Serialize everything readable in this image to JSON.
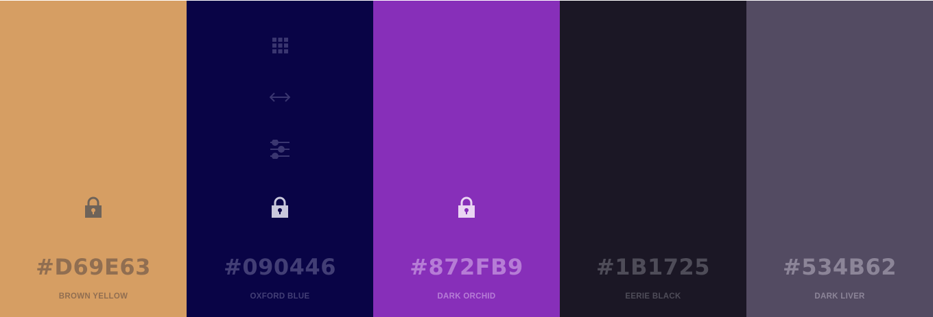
{
  "colors": [
    {
      "hex": "#D69E63",
      "name": "BROWN YELLOW",
      "bg": "#D69E63",
      "text": "rgba(60,50,60,0.45)",
      "lock": "#6e6359",
      "lock_visible": true
    },
    {
      "hex": "#090446",
      "name": "OXFORD BLUE",
      "bg": "#090446",
      "text": "rgba(200,200,230,0.3)",
      "lock": "#c9c8dc",
      "lock_visible": true,
      "tools": [
        "grid-icon",
        "arrows-horizontal-icon",
        "sliders-icon"
      ]
    },
    {
      "hex": "#872FB9",
      "name": "DARK ORCHID",
      "bg": "#872FB9",
      "text": "rgba(240,220,250,0.45)",
      "lock": "#ead5f3",
      "lock_visible": true
    },
    {
      "hex": "#1B1725",
      "name": "EERIE BLACK",
      "bg": "#1B1725",
      "text": "rgba(200,200,210,0.3)",
      "lock": "#888",
      "lock_visible": false
    },
    {
      "hex": "#534B62",
      "name": "DARK LIVER",
      "bg": "#534B62",
      "text": "rgba(210,205,220,0.45)",
      "lock": "#aaa",
      "lock_visible": false
    }
  ]
}
